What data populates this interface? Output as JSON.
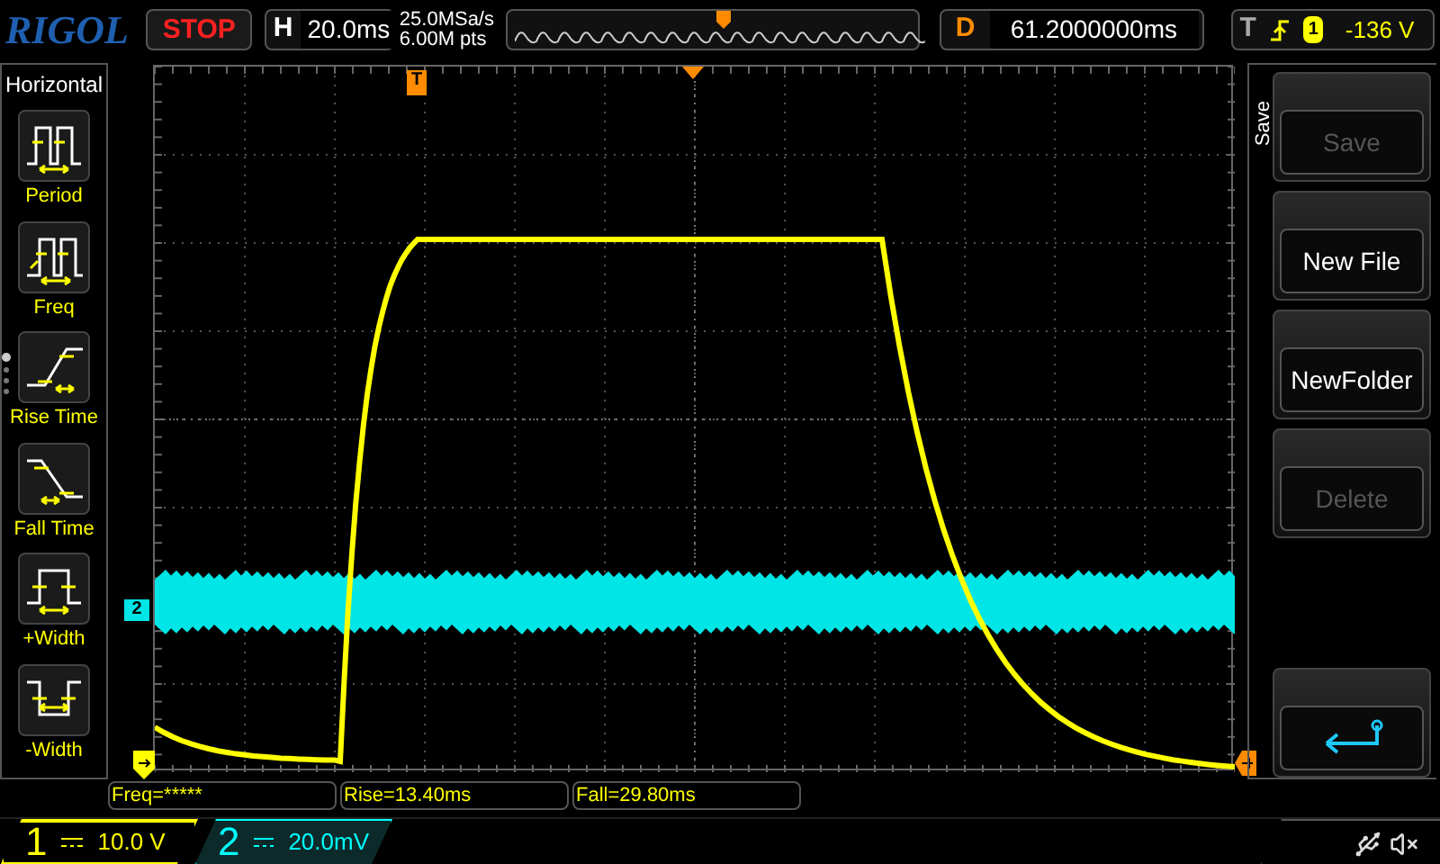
{
  "brand": "RIGOL",
  "run_state": "STOP",
  "timebase": {
    "label": "H",
    "value": "20.0ms"
  },
  "acquisition": {
    "sample_rate": "25.0MSa/s",
    "depth": "6.00M pts"
  },
  "trigger_marker": "T",
  "delay": {
    "label": "D",
    "value": "61.2000000ms"
  },
  "trigger": {
    "label": "T",
    "source": "1",
    "level": "-136 V"
  },
  "left_menu": {
    "title": "Horizontal",
    "items": [
      {
        "label": "Period",
        "kind": "period"
      },
      {
        "label": "Freq",
        "kind": "freq"
      },
      {
        "label": "Rise Time",
        "kind": "rise"
      },
      {
        "label": "Fall Time",
        "kind": "fall"
      },
      {
        "label": "+Width",
        "kind": "pwidth"
      },
      {
        "label": "-Width",
        "kind": "nwidth"
      }
    ],
    "pages": [
      {
        "selected": true
      },
      {
        "selected": false
      },
      {
        "selected": false
      },
      {
        "selected": false
      }
    ]
  },
  "channel_marker": "2",
  "right_menu": {
    "title": "Save",
    "buttons": [
      {
        "kind": "text",
        "label": "Save",
        "disabled": true
      },
      {
        "kind": "text",
        "label": "New File",
        "disabled": false
      },
      {
        "kind": "text",
        "label": "NewFolder",
        "disabled": false
      },
      {
        "kind": "text",
        "label": "Delete",
        "disabled": true
      },
      {
        "kind": "spacer"
      },
      {
        "kind": "back",
        "disabled": false
      }
    ]
  },
  "measurements": [
    "Freq=*****",
    "Rise=13.40ms",
    "Fall=29.80ms"
  ],
  "channels": [
    {
      "number": "1",
      "scale": "10.0 V",
      "color": "#ffff00",
      "active": true
    },
    {
      "number": "2",
      "scale": "20.0mV",
      "color": "#00ffff",
      "active": false
    }
  ]
}
